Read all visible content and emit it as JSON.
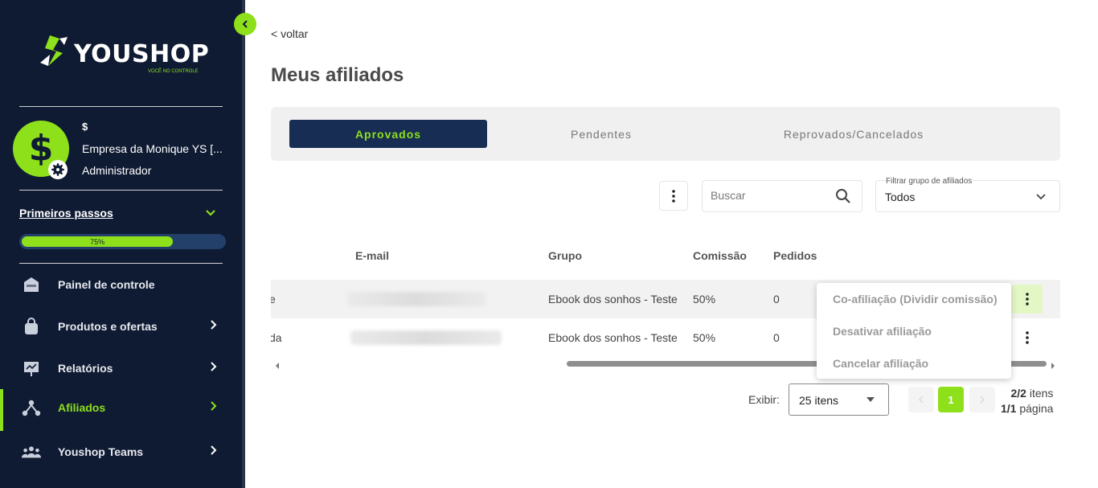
{
  "sidebar": {
    "logo_text": "YOUSHOP",
    "logo_tagline": "VOCÊ NO CONTROLE",
    "user": {
      "symbol": "$",
      "company": "Empresa da Monique YS [...",
      "role": "Administrador",
      "avatar_icon": "dollar-icon"
    },
    "steps": {
      "title": "Primeiros passos",
      "progress_percent": 75,
      "progress_label": "75%"
    },
    "nav": [
      {
        "label": "Painel de controle",
        "icon": "home-icon",
        "has_chevron": false,
        "active": false
      },
      {
        "label": "Produtos e ofertas",
        "icon": "bag-icon",
        "has_chevron": true,
        "active": false
      },
      {
        "label": "Relatórios",
        "icon": "report-icon",
        "has_chevron": true,
        "active": false
      },
      {
        "label": "Afiliados",
        "icon": "affiliates-icon",
        "has_chevron": true,
        "active": true
      },
      {
        "label": "Youshop Teams",
        "icon": "team-icon",
        "has_chevron": true,
        "active": false
      }
    ]
  },
  "main": {
    "back_label": "< voltar",
    "title": "Meus afiliados",
    "tabs": [
      {
        "label": "Aprovados",
        "active": true
      },
      {
        "label": "Pendentes",
        "active": false
      },
      {
        "label": "Reprovados/Cancelados",
        "active": false
      }
    ],
    "search": {
      "placeholder": "Buscar"
    },
    "filter": {
      "label": "Filtrar grupo de afiliados",
      "value": "Todos"
    },
    "table": {
      "columns": [
        "E-mail",
        "Grupo",
        "Comissão",
        "Pedidos"
      ],
      "rows": [
        {
          "name_tail": "e",
          "group": "Ebook dos sonhos - Teste",
          "commission": "50%",
          "orders": "0"
        },
        {
          "name_tail": "da",
          "group": "Ebook dos sonhos - Teste",
          "commission": "50%",
          "orders": "0"
        }
      ]
    },
    "row_menu": [
      "Co-afiliação (Dividir comissão)",
      "Desativar afiliação",
      "Cancelar afiliação"
    ],
    "pagination": {
      "show_label": "Exibir:",
      "page_size": "25 itens",
      "current_page": "1",
      "items_count": "2/2",
      "items_word": "itens",
      "pages_count": "1/1",
      "pages_word": "página"
    }
  },
  "colors": {
    "sidebar_bg": "#0f1b33",
    "accent_green": "#8ee01b",
    "tab_active_bg": "#172d54"
  }
}
